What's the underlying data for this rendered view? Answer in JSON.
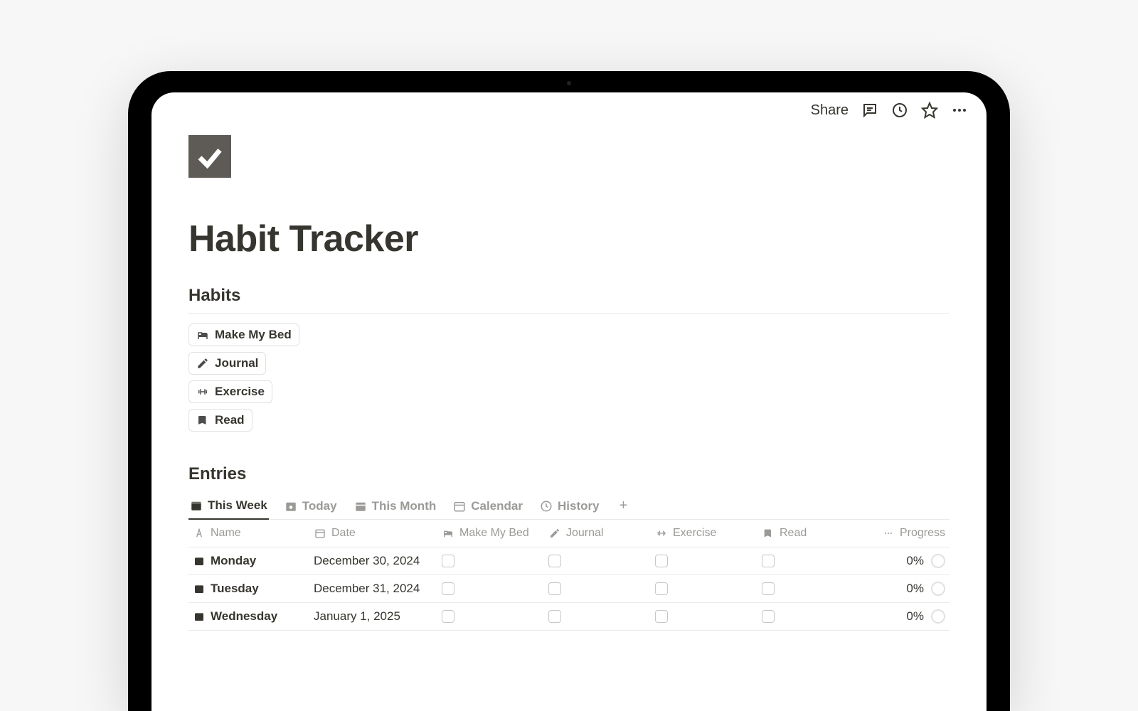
{
  "topbar": {
    "share_label": "Share"
  },
  "page": {
    "title": "Habit Tracker"
  },
  "sections": {
    "habits_title": "Habits",
    "entries_title": "Entries"
  },
  "habits": [
    {
      "icon": "bed-icon",
      "label": "Make My Bed"
    },
    {
      "icon": "pencil-icon",
      "label": "Journal"
    },
    {
      "icon": "dumbbell-icon",
      "label": "Exercise"
    },
    {
      "icon": "book-icon",
      "label": "Read"
    }
  ],
  "views": [
    {
      "icon": "calendar-week-icon",
      "label": "This Week",
      "active": true
    },
    {
      "icon": "calendar-day-icon",
      "label": "Today",
      "active": false
    },
    {
      "icon": "calendar-month-icon",
      "label": "This Month",
      "active": false
    },
    {
      "icon": "calendar-icon",
      "label": "Calendar",
      "active": false
    },
    {
      "icon": "clock-icon",
      "label": "History",
      "active": false
    }
  ],
  "columns": {
    "name": {
      "icon": "text-icon",
      "label": "Name"
    },
    "date": {
      "icon": "calendar-icon",
      "label": "Date"
    },
    "make_bed": {
      "icon": "bed-icon",
      "label": "Make My Bed"
    },
    "journal": {
      "icon": "pencil-icon",
      "label": "Journal"
    },
    "exercise": {
      "icon": "dumbbell-icon",
      "label": "Exercise"
    },
    "read": {
      "icon": "book-icon",
      "label": "Read"
    },
    "progress": {
      "icon": "dots-icon",
      "label": "Progress"
    }
  },
  "rows": [
    {
      "name": "Monday",
      "date": "December 30, 2024",
      "make_bed": false,
      "journal": false,
      "exercise": false,
      "read": false,
      "progress": "0%"
    },
    {
      "name": "Tuesday",
      "date": "December 31, 2024",
      "make_bed": false,
      "journal": false,
      "exercise": false,
      "read": false,
      "progress": "0%"
    },
    {
      "name": "Wednesday",
      "date": "January 1, 2025",
      "make_bed": false,
      "journal": false,
      "exercise": false,
      "read": false,
      "progress": "0%"
    }
  ]
}
